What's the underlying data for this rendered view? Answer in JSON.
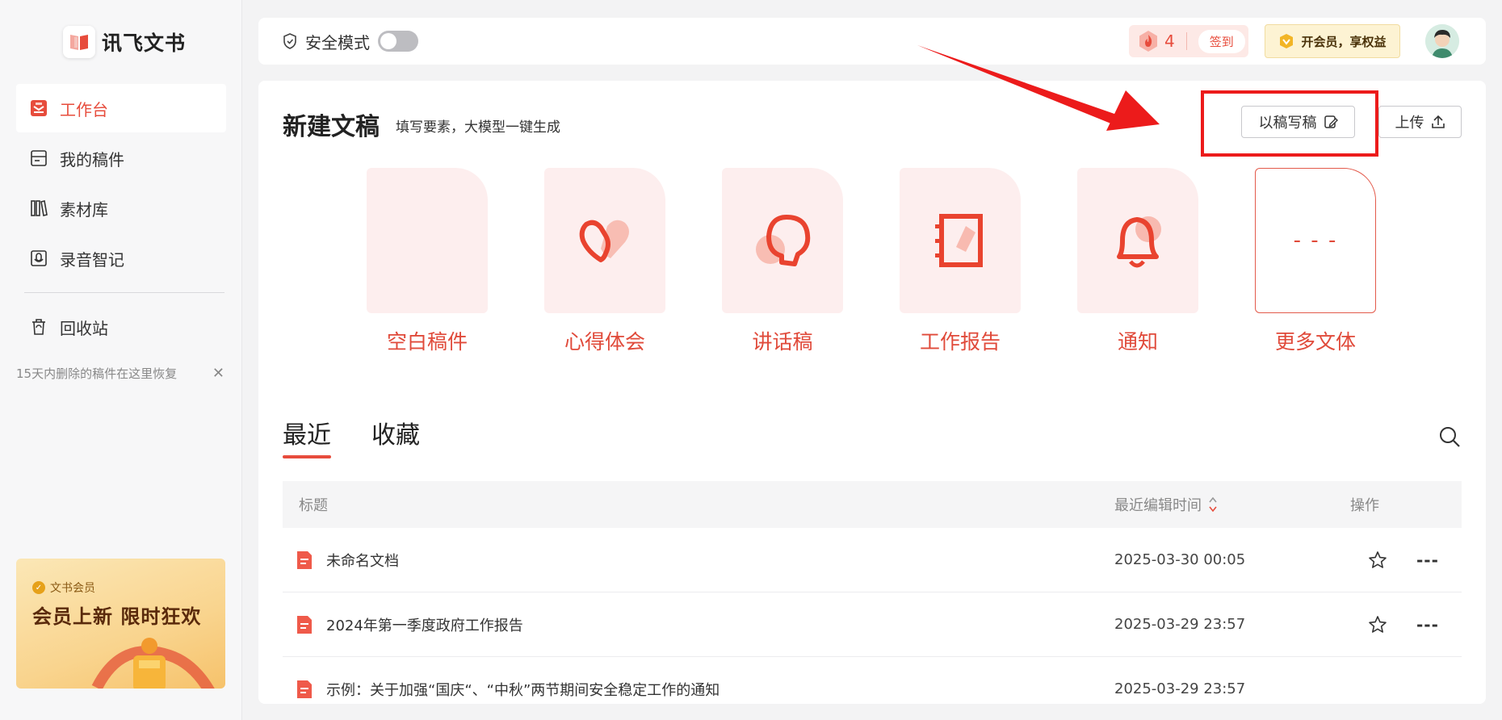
{
  "brand": {
    "name": "讯飞文书"
  },
  "sidebar": {
    "items": [
      {
        "label": "工作台",
        "icon": "workbench-icon",
        "active": true
      },
      {
        "label": "我的稿件",
        "icon": "drafts-icon",
        "active": false
      },
      {
        "label": "素材库",
        "icon": "library-icon",
        "active": false
      },
      {
        "label": "录音智记",
        "icon": "recording-icon",
        "active": false
      }
    ],
    "trash": {
      "label": "回收站",
      "icon": "trash-icon"
    },
    "recover_tip": "15天内删除的稿件在这里恢复",
    "promo": {
      "badge": "文书会员",
      "title": "会员上新 限时狂欢"
    }
  },
  "topbar": {
    "safe_mode_label": "安全模式",
    "safe_mode_on": false,
    "streak_count": "4",
    "signin_label": "签到",
    "vip_label": "开会员，享权益"
  },
  "main": {
    "title": "新建文稿",
    "subtitle": "填写要素，大模型一键生成",
    "write_from_draft_label": "以稿写稿",
    "upload_label": "上传",
    "templates": [
      {
        "label": "空白稿件",
        "icon": "blank-doc-icon"
      },
      {
        "label": "心得体会",
        "icon": "heart-icon"
      },
      {
        "label": "讲话稿",
        "icon": "speech-head-icon"
      },
      {
        "label": "工作报告",
        "icon": "notebook-icon"
      },
      {
        "label": "通知",
        "icon": "bell-icon"
      },
      {
        "label": "更多文体",
        "icon": "more-icon",
        "symbol": "- - -"
      }
    ],
    "tabs": [
      {
        "label": "最近",
        "active": true
      },
      {
        "label": "收藏",
        "active": false
      }
    ],
    "table": {
      "headers": {
        "title": "标题",
        "time": "最近编辑时间",
        "op": "操作"
      },
      "rows": [
        {
          "title": "未命名文档",
          "time": "2025-03-30 00:05"
        },
        {
          "title": "2024年第一季度政府工作报告",
          "time": "2025-03-29 23:57"
        },
        {
          "title": "示例：关于加强“国庆“、“中秋”两节期间安全稳定工作的通知",
          "time": "2025-03-29 23:57"
        }
      ],
      "more_symbol": "---"
    }
  },
  "colors": {
    "accent": "#e74c3c",
    "annotation": "#ec1b1b"
  }
}
